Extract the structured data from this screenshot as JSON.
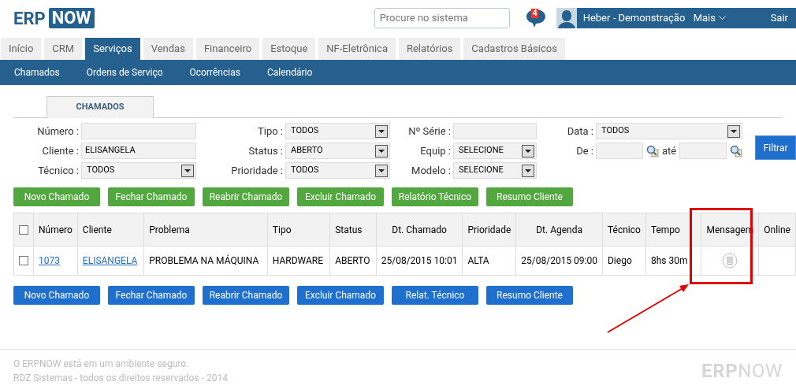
{
  "header": {
    "logo": [
      "ERP",
      "NOW"
    ],
    "search": {
      "placeholder": "Procure no sistema"
    },
    "notifications": "4",
    "user": "Heber - Demonstração",
    "more": "Mais",
    "logout": "Sair"
  },
  "tabs": [
    {
      "label": "Início",
      "selected": false
    },
    {
      "label": "CRM",
      "selected": false
    },
    {
      "label": "Serviços",
      "selected": true
    },
    {
      "label": "Vendas",
      "selected": false
    },
    {
      "label": "Financeiro",
      "selected": false
    },
    {
      "label": "Estoque",
      "selected": false
    },
    {
      "label": "NF-Eletrônica",
      "selected": false
    },
    {
      "label": "Relatórios",
      "selected": false
    },
    {
      "label": "Cadastros Básicos",
      "selected": false
    }
  ],
  "subnav": [
    "Chamados",
    "Ordens de Serviço",
    "Ocorrências",
    "Calendário"
  ],
  "section_tab": "CHAMADOS",
  "filters": [
    [
      {
        "kind": "text",
        "label": "Número :"
      },
      {
        "kind": "text",
        "label": "Cliente :",
        "value": "ELISANGELA"
      },
      {
        "kind": "select",
        "label": "Técnico :",
        "value": "TODOS"
      }
    ],
    [
      {
        "kind": "select",
        "label": "Tipo :",
        "value": "TODOS"
      },
      {
        "kind": "select",
        "label": "Status :",
        "value": "ABERTO"
      },
      {
        "kind": "select",
        "label": "Prioridade :",
        "value": "TODOS"
      }
    ],
    [
      {
        "kind": "text",
        "label": "Nº Série :"
      },
      {
        "kind": "select",
        "label": "Equip :",
        "value": "SELECIONE"
      },
      {
        "kind": "select",
        "label": "Modelo :",
        "value": "SELECIONE"
      }
    ],
    [
      {
        "kind": "select",
        "label": "Data :",
        "value": "TODOS"
      },
      {
        "kind": "range",
        "label": "De :",
        "between": "até"
      }
    ]
  ],
  "filter_button": "Filtrar",
  "top_buttons": [
    "Novo Chamado",
    "Fechar Chamado",
    "Reabrir Chamado",
    "Excluir Chamado",
    "Relatório Técnico",
    "Resumo Cliente"
  ],
  "table": {
    "header_checkbox": {
      "checked": false
    },
    "columns": [
      "Número",
      "Cliente",
      "Problema",
      "Tipo",
      "Status",
      "Dt. Chamado",
      "Prioridade",
      "Dt. Agenda",
      "Técnico",
      "Tempo",
      "Mensagem",
      "Online"
    ],
    "rows": [
      {
        "checked": false,
        "cells": [
          "1073",
          "ELISANGELA",
          "PROBLEMA NA MÁQUINA",
          "HARDWARE",
          "ABERTO",
          "25/08/2015 10:01",
          "ALTA",
          "25/08/2015 09:00",
          "Diego",
          "8hs 30m"
        ]
      }
    ]
  },
  "bottom_buttons": [
    "Novo Chamado",
    "Fechar Chamado",
    "Reabrir Chamado",
    "Excluir Chamado",
    "Relat. Técnico",
    "Resumo Cliente"
  ],
  "footer": {
    "lines": [
      "O ERPNOW está em um ambiente seguro.",
      "RDZ Sistemas - todos os direitos reservados - 2014"
    ],
    "logo": [
      "ERP",
      "NOW"
    ]
  }
}
